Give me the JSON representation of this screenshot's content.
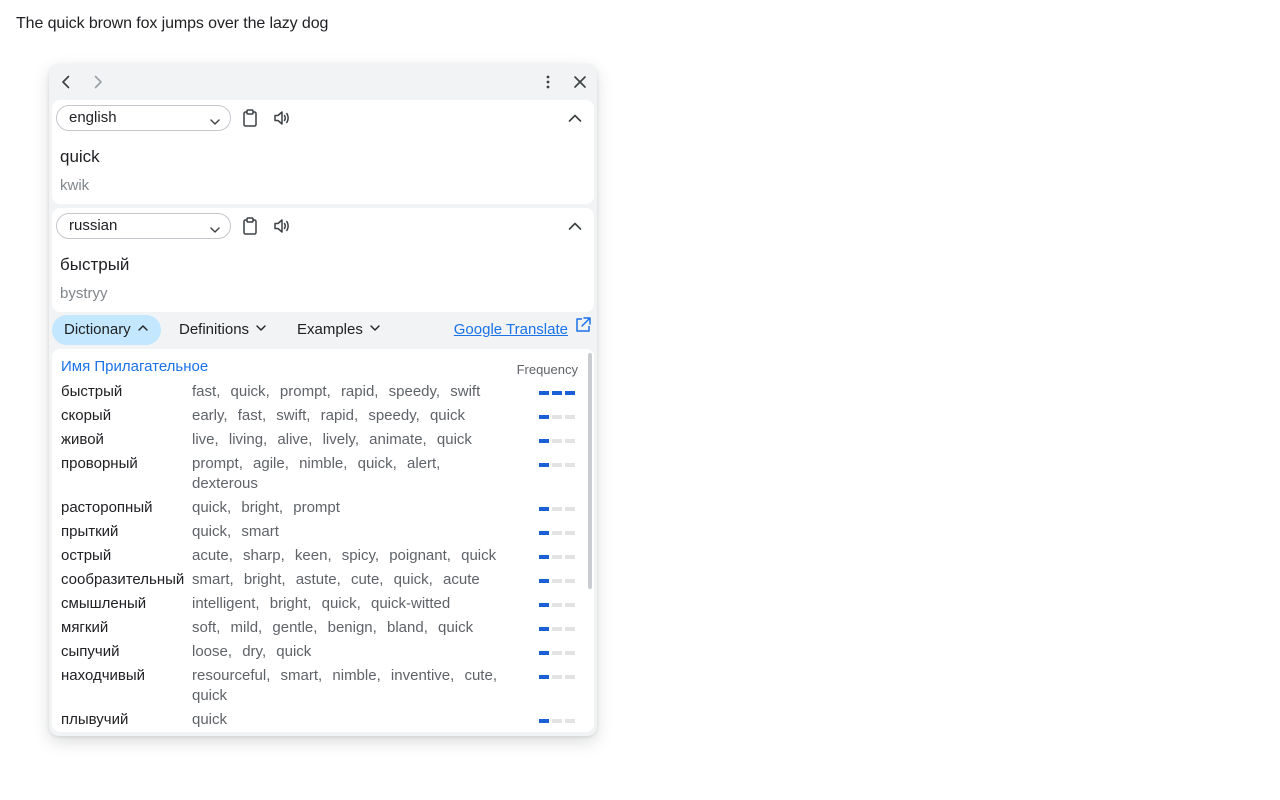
{
  "page": {
    "sentence": "The quick brown fox jumps over the lazy dog"
  },
  "toolbar": {
    "back_icon": "chevron-left-icon",
    "forward_icon": "chevron-right-icon",
    "menu_icon": "more-vert-icon",
    "close_icon": "close-icon"
  },
  "source": {
    "language": "english",
    "text": "quick",
    "transliteration": "kwik"
  },
  "target": {
    "language": "russian",
    "text": "быстрый",
    "transliteration": "bystryy"
  },
  "tabs": [
    {
      "label": "Dictionary",
      "active": true
    },
    {
      "label": "Definitions",
      "active": false
    },
    {
      "label": "Examples",
      "active": false
    }
  ],
  "google_translate_label": "Google Translate",
  "dictionary": {
    "part_of_speech": "Имя Прилагательное",
    "frequency_label": "Frequency",
    "entries": [
      {
        "word": "быстрый",
        "translations": [
          "fast",
          "quick",
          "prompt",
          "rapid",
          "speedy",
          "swift"
        ],
        "frequency": 3
      },
      {
        "word": "скорый",
        "translations": [
          "early",
          "fast",
          "swift",
          "rapid",
          "speedy",
          "quick"
        ],
        "frequency": 1
      },
      {
        "word": "живой",
        "translations": [
          "live",
          "living",
          "alive",
          "lively",
          "animate",
          "quick"
        ],
        "frequency": 1
      },
      {
        "word": "проворный",
        "translations": [
          "prompt",
          "agile",
          "nimble",
          "quick",
          "alert",
          "dexterous"
        ],
        "frequency": 1
      },
      {
        "word": "расторопный",
        "translations": [
          "quick",
          "bright",
          "prompt"
        ],
        "frequency": 1
      },
      {
        "word": "прыткий",
        "translations": [
          "quick",
          "smart"
        ],
        "frequency": 1
      },
      {
        "word": "острый",
        "translations": [
          "acute",
          "sharp",
          "keen",
          "spicy",
          "poignant",
          "quick"
        ],
        "frequency": 1
      },
      {
        "word": "сообразительный",
        "translations": [
          "smart",
          "bright",
          "astute",
          "cute",
          "quick",
          "acute"
        ],
        "frequency": 1
      },
      {
        "word": "смышленый",
        "translations": [
          "intelligent",
          "bright",
          "quick",
          "quick-witted"
        ],
        "frequency": 1
      },
      {
        "word": "мягкий",
        "translations": [
          "soft",
          "mild",
          "gentle",
          "benign",
          "bland",
          "quick"
        ],
        "frequency": 1
      },
      {
        "word": "сыпучий",
        "translations": [
          "loose",
          "dry",
          "quick"
        ],
        "frequency": 1
      },
      {
        "word": "находчивый",
        "translations": [
          "resourceful",
          "smart",
          "nimble",
          "inventive",
          "cute",
          "quick"
        ],
        "frequency": 1
      },
      {
        "word": "плывучий",
        "translations": [
          "quick"
        ],
        "frequency": 1
      }
    ]
  },
  "colors": {
    "accent": "#1a73e8",
    "active_tab": "#c2e7ff",
    "frequency_on": "#1a5fd6",
    "frequency_off": "#e3e3e3"
  }
}
